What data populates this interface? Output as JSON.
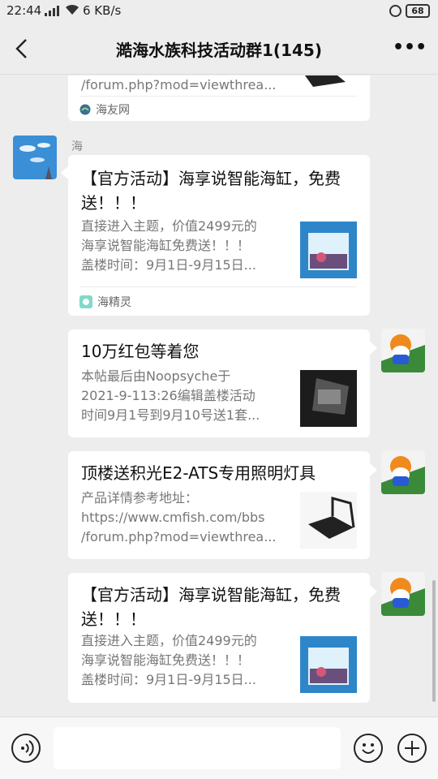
{
  "status": {
    "time": "22:44",
    "network": "4G",
    "speed": "6 KB/s",
    "battery": "68"
  },
  "header": {
    "title": "澔海水族科技活动群1(145)"
  },
  "messages": [
    {
      "desc_tail": "/forum.php?mod=viewthrea...",
      "source": "海友网"
    },
    {
      "sender": "海",
      "title": "【官方活动】海享说智能海缸，免费送！！！",
      "desc": "直接进入主题，价值2499元的\n海享说智能海缸免费送！！！\n盖楼时间：9月1日-9月15日...",
      "source": "海精灵"
    },
    {
      "title": "10万红包等着您",
      "desc": "本帖最后由Noopsyche于\n2021-9-113:26编辑盖楼活动\n时间9月1号到9月10号送1套..."
    },
    {
      "title": "顶楼送积光E2-ATS专用照明灯具",
      "desc": "产品详情参考地址：\nhttps://www.cmfish.com/bbs\n/forum.php?mod=viewthrea..."
    },
    {
      "title": "【官方活动】海享说智能海缸，免费送！！！",
      "desc": "直接进入主题，价值2499元的\n海享说智能海缸免费送！！！\n盖楼时间：9月1日-9月15日..."
    }
  ],
  "input": {
    "placeholder": ""
  },
  "colors": {
    "background": "#ededed",
    "bubble": "#ffffff",
    "secondary_text": "#777777"
  }
}
